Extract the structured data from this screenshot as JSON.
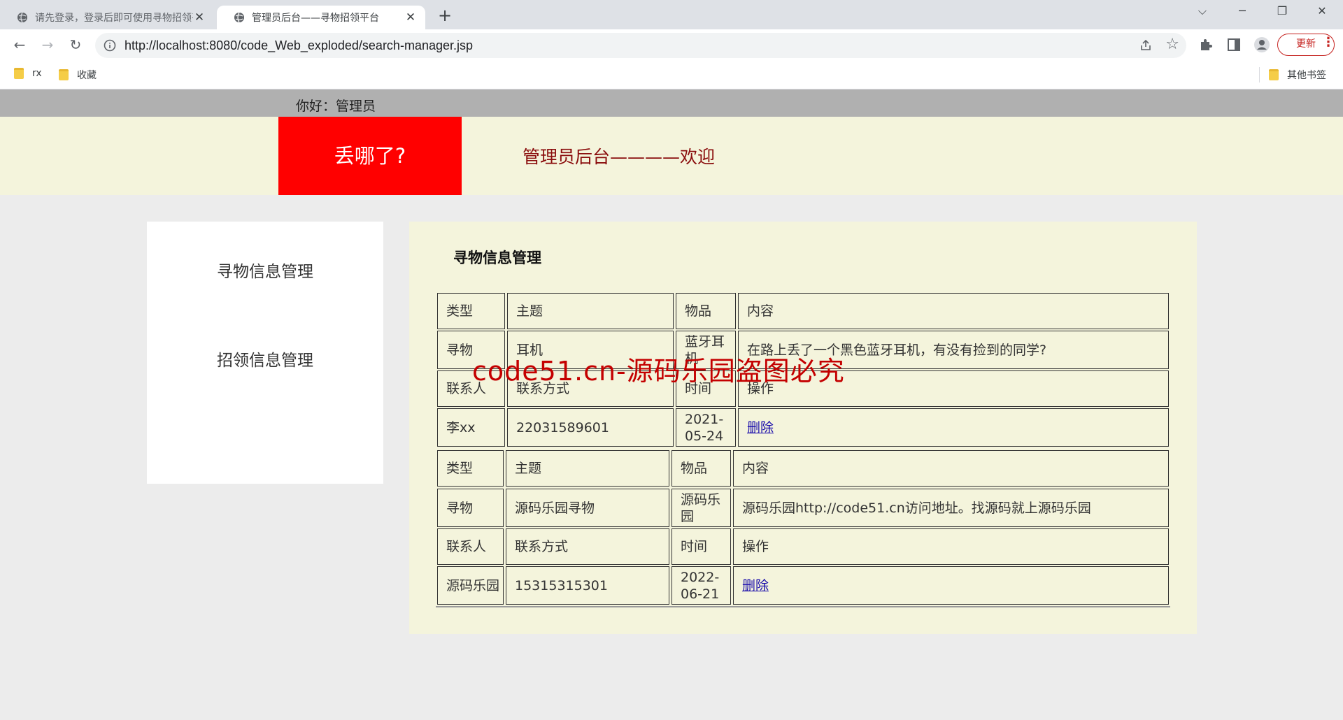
{
  "browser": {
    "tabs": [
      {
        "title": "请先登录，登录后即可使用寻物招领平台",
        "active": false
      },
      {
        "title": "管理员后台——寻物招领平台",
        "active": true
      }
    ],
    "url": "http://localhost:8080/code_Web_exploded/search-manager.jsp",
    "update_label": "更新",
    "bookmarks": [
      {
        "label": "rx"
      },
      {
        "label": "收藏"
      }
    ],
    "other_bookmarks": "其他书签"
  },
  "page": {
    "greeting": "你好：管理员",
    "logo": "丢哪了?",
    "header_title": "管理员后台————欢迎",
    "sidebar": [
      {
        "label": "寻物信息管理"
      },
      {
        "label": "招领信息管理"
      }
    ],
    "main_title": "寻物信息管理",
    "records": [
      {
        "h_type": "类型",
        "h_subject": "主题",
        "h_item": "物品",
        "h_content": "内容",
        "type": "寻物",
        "subject": "耳机",
        "item": "蓝牙耳机",
        "content": "在路上丢了一个黑色蓝牙耳机，有没有捡到的同学?",
        "h_contact": "联系人",
        "h_phone": "联系方式",
        "h_time": "时间",
        "h_op": "操作",
        "contact": "李xx",
        "phone": "22031589601",
        "time": "2021-05-24",
        "op": "删除"
      },
      {
        "h_type": "类型",
        "h_subject": "主题",
        "h_item": "物品",
        "h_content": "内容",
        "type": "寻物",
        "subject": "源码乐园寻物",
        "item": "源码乐园",
        "content": "源码乐园http://code51.cn访问地址。找源码就上源码乐园",
        "h_contact": "联系人",
        "h_phone": "联系方式",
        "h_time": "时间",
        "h_op": "操作",
        "contact": "源码乐园",
        "phone": "15315315301",
        "time": "2022-06-21",
        "op": "删除"
      }
    ],
    "watermark": "code51.cn-源码乐园盗图必究"
  }
}
